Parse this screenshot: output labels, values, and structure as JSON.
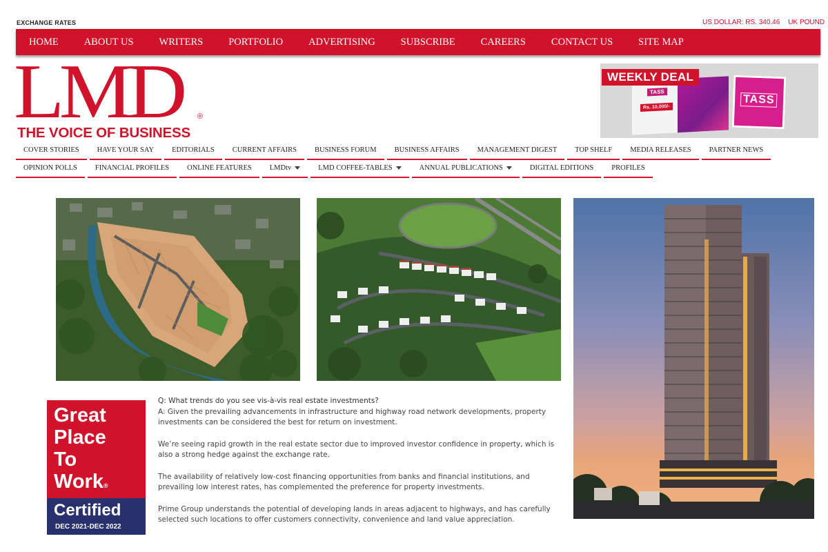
{
  "topbar": {
    "exchange_label": "EXCHANGE RATES",
    "rates": [
      "US DOLLAR: RS. 340.46",
      "UK POUND"
    ]
  },
  "main_nav": [
    "HOME",
    "ABOUT US",
    "WRITERS",
    "PORTFOLIO",
    "ADVERTISING",
    "SUBSCRIBE",
    "CAREERS",
    "CONTACT US",
    "SITE MAP"
  ],
  "logo": {
    "wordmark": "LMD",
    "registered": "®",
    "tagline": "THE VOICE OF BUSINESS"
  },
  "ad": {
    "headline": "WEEKLY DEAL",
    "brand": "TASS",
    "price": "Rs. 10,000/-"
  },
  "sub_nav_row1": [
    {
      "label": "COVER STORIES",
      "dropdown": false
    },
    {
      "label": "HAVE YOUR SAY",
      "dropdown": false
    },
    {
      "label": "EDITORIALS",
      "dropdown": false
    },
    {
      "label": "CURRENT AFFAIRS",
      "dropdown": false
    },
    {
      "label": "BUSINESS FORUM",
      "dropdown": false
    },
    {
      "label": "BUSINESS AFFAIRS",
      "dropdown": false
    },
    {
      "label": "MANAGEMENT DIGEST",
      "dropdown": false
    },
    {
      "label": "TOP SHELF",
      "dropdown": false
    },
    {
      "label": "MEDIA RELEASES",
      "dropdown": false
    },
    {
      "label": "PARTNER NEWS",
      "dropdown": false
    }
  ],
  "sub_nav_row2": [
    {
      "label": "OPINION POLLS",
      "dropdown": false
    },
    {
      "label": "FINANCIAL PROFILES",
      "dropdown": false
    },
    {
      "label": "ONLINE FEATURES",
      "dropdown": false
    },
    {
      "label": "LMDtv",
      "dropdown": true
    },
    {
      "label": "LMD COFFEE-TABLES",
      "dropdown": true
    },
    {
      "label": "ANNUAL PUBLICATIONS",
      "dropdown": true
    },
    {
      "label": "DIGITAL EDITIONS",
      "dropdown": false
    },
    {
      "label": "PROFILES",
      "dropdown": false
    }
  ],
  "badge": {
    "lines": [
      "Great",
      "Place",
      "To",
      "Work"
    ],
    "registered": "®",
    "certified": "Certified",
    "dates": "DEC 2021-DEC 2022"
  },
  "article": {
    "question": "Q: What trends do you see vis-à-vis real estate investments?",
    "answer": "A: Given the prevailing advancements in infrastructure and highway road network developments, property investments can be considered the best for return on investment.",
    "paragraphs": [
      "We’re seeing rapid growth in the real estate sector due to improved investor confidence in property, which is also a strong hedge against the exchange rate.",
      "The availability of relatively low-cost financing opportunities from banks and financial institutions, and prevailing low interest rates, has complemented the preference for property investments.",
      "Prime Group understands the potential of developing lands in areas adjacent to highways, and has carefully selected such locations to offer customers connectivity, convenience and land value appreciation."
    ]
  },
  "colors": {
    "brand_red": "#d0122b",
    "badge_navy": "#28306e"
  }
}
